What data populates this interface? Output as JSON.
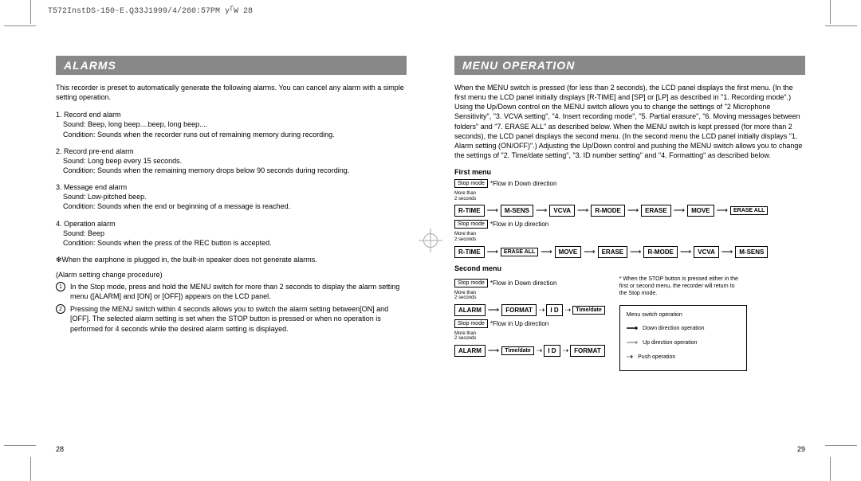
{
  "header_code": "T572InstDS-150-E.Q33J1999/4/260:57PM y｢W 28",
  "left": {
    "section": "ALARMS",
    "intro": "This recorder is preset to automatically generate the following alarms. You can cancel any alarm with a simple setting operation.",
    "alarms": [
      {
        "n": "1.",
        "title": "Record end alarm",
        "sound": "Sound: Beep, long beep....beep, long beep....",
        "cond": "Condition: Sounds when the recorder runs out of remaining memory during recording."
      },
      {
        "n": "2.",
        "title": "Record pre-end alarm",
        "sound": "Sound: Long beep every 15 seconds.",
        "cond": "Condition: Sounds when the remaining memory drops below 90 seconds during recording."
      },
      {
        "n": "3.",
        "title": "Message end alarm",
        "sound": "Sound: Low-pitched beep.",
        "cond": "Condition: Sounds when the end or beginning of a message is reached."
      },
      {
        "n": "4.",
        "title": "Operation alarm",
        "sound": "Sound: Beep",
        "cond": "Condition: Sounds when the press of the REC button is accepted."
      }
    ],
    "earphone_note": "✻When the earphone is plugged in, the built-in speaker does not generate alarms.",
    "proc_title": "(Alarm setting change procedure)",
    "proc": [
      "In the Stop mode, press and hold the MENU switch for more than 2 seconds to display the alarm setting menu ([ALARM] and [ON] or [OFF]) appears on the LCD panel.",
      "Pressing the MENU switch within 4 seconds allows you to switch the alarm setting between[ON] and [OFF]. The selected alarm setting is set when the STOP button is pressed or when no operation is performed for 4 seconds while the desired alarm setting is displayed."
    ],
    "page_num": "28"
  },
  "right": {
    "section": "MENU OPERATION",
    "intro": "When the MENU switch is pressed (for less than 2 seconds), the LCD panel displays the first menu. (In the first menu the LCD panel initially displays [R-TIME] and [SP] or [LP] as described in \"1. Recording mode\".) Using the Up/Down control on the MENU switch allows you to change the settings of \"2 Microphone Sensitivity\", \"3. VCVA setting\", \"4. Insert recording mode\", \"5. Partial erasure\", \"6. Moving messages between folders\" and \"7. ERASE ALL\" as described below. When the MENU switch is kept pressed (for more than 2 seconds), the LCD panel displays the second menu. (In the second menu the LCD panel initially displays \"1. Alarm setting (ON/OFF)\".) Adjusting the Up/Down control and pushing the MENU switch allows you to change the settings of \"2. Time/date setting\", \"3. ID number setting\" and \"4. Formatting\" as described below.",
    "first_menu_label": "First menu",
    "second_menu_label": "Second menu",
    "stop_mode": "Stop mode",
    "more_than": "More than",
    "two_sec": "2 seconds",
    "flow_down": "*Flow in Down direction",
    "flow_up": "*Flow in Up direction",
    "first_items": [
      "R-TIME",
      "M-SENS",
      "VCVA",
      "R-MODE",
      "ERASE",
      "MOVE",
      "ERASE ALL"
    ],
    "first_items_rev": [
      "R-TIME",
      "ERASE ALL",
      "MOVE",
      "ERASE",
      "R-MODE",
      "VCVA",
      "M-SENS"
    ],
    "second_items": [
      "ALARM",
      "FORMAT",
      "I D",
      "Time/date"
    ],
    "second_items_rev": [
      "ALARM",
      "Time/date",
      "I D",
      "FORMAT"
    ],
    "stop_note": "* When the STOP button is pressed either in the first or second menu, the recorder will return to the Stop mode.",
    "legend_title": "Menu switch operation",
    "legend_down": "Down direction operation",
    "legend_up": "Up direction operation",
    "legend_push": "Push operation",
    "page_num": "29"
  }
}
